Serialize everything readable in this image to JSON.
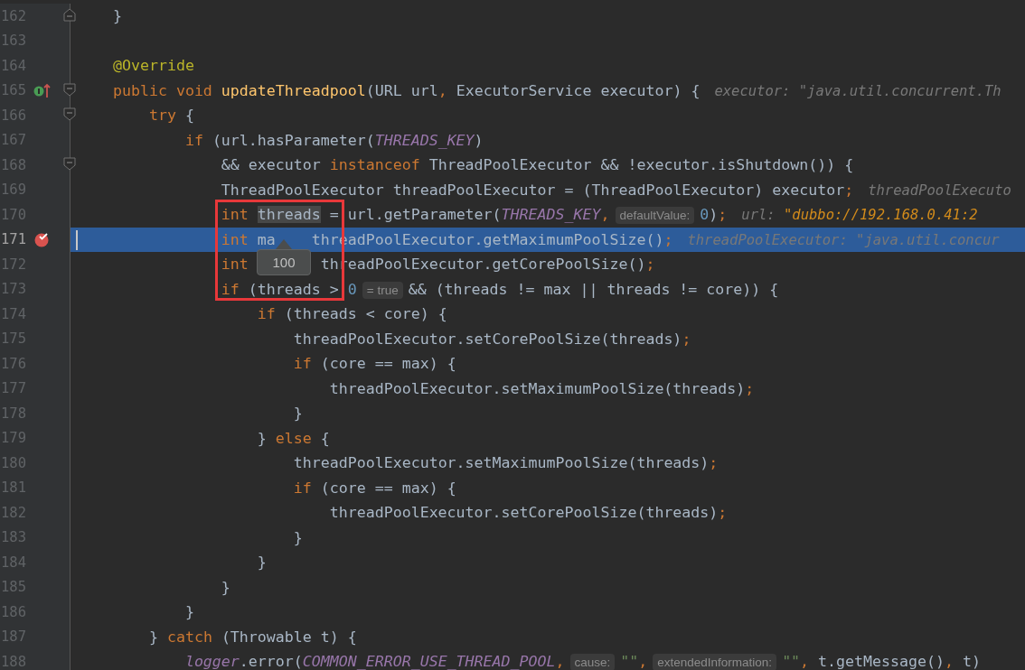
{
  "editor": {
    "lines": [
      {
        "number": "162",
        "current": false,
        "fold_end": true,
        "tokens": [
          {
            "text": "    }",
            "kind": "p"
          }
        ]
      },
      {
        "number": "163",
        "current": false
      },
      {
        "number": "164",
        "current": false,
        "tokens": [
          {
            "text": "    @Override",
            "kind": "a"
          }
        ]
      },
      {
        "number": "165",
        "current": false,
        "implements_marker": true,
        "fold_start": true,
        "tokens": [
          {
            "text": "    public void ",
            "kind": "k"
          },
          {
            "text": "updateThreadpool",
            "kind": "m"
          },
          {
            "text": "(URL url",
            "kind": "p"
          },
          {
            "text": ",",
            "kind": "o"
          },
          {
            "text": " ExecutorService executor) {",
            "kind": "p"
          },
          {
            "text": "executor: \"java.util.concurrent.Th",
            "kind": "d"
          }
        ]
      },
      {
        "number": "166",
        "current": false,
        "fold_start": true,
        "tokens": [
          {
            "text": "        try",
            "kind": "k"
          },
          {
            "text": " {",
            "kind": "p"
          }
        ]
      },
      {
        "number": "167",
        "current": false,
        "tokens": [
          {
            "text": "            if",
            "kind": "k"
          },
          {
            "text": " (url.hasParameter(",
            "kind": "p"
          },
          {
            "text": "THREADS_KEY",
            "kind": "c"
          },
          {
            "text": ")",
            "kind": "p"
          }
        ]
      },
      {
        "number": "168",
        "current": false,
        "fold_start": true,
        "tokens": [
          {
            "text": "                && executor ",
            "kind": "p"
          },
          {
            "text": "instanceof",
            "kind": "k"
          },
          {
            "text": " ThreadPoolExecutor && !executor.isShutdown()) {",
            "kind": "p"
          }
        ]
      },
      {
        "number": "169",
        "current": false,
        "tokens": [
          {
            "text": "                ThreadPoolExecutor threadPoolExecutor = (ThreadPoolExecutor) executor",
            "kind": "p"
          },
          {
            "text": ";",
            "kind": "o"
          },
          {
            "text": "threadPoolExecuto",
            "kind": "d"
          }
        ]
      },
      {
        "number": "170",
        "current": false,
        "tokens": [
          {
            "text": "                int ",
            "kind": "k"
          },
          {
            "text": "threads",
            "kind": "sel"
          },
          {
            "text": " = url.getParameter(",
            "kind": "p"
          },
          {
            "text": "THREADS_KEY",
            "kind": "c"
          },
          {
            "text": ",",
            "kind": "o"
          },
          {
            "text": "defaultValue:",
            "kind": "h"
          },
          {
            "text": "0",
            "kind": "n"
          },
          {
            "text": ")",
            "kind": "p"
          },
          {
            "text": ";",
            "kind": "o"
          },
          {
            "text": "url: ",
            "kind": "d"
          },
          {
            "text": "\"dubbo://192.168.0.41:2",
            "kind": "ds"
          }
        ]
      },
      {
        "number": "171",
        "current": true,
        "breakpoint": true,
        "tokens": [
          {
            "text": "                int",
            "kind": "k"
          },
          {
            "text": " ma",
            "kind": "p"
          },
          {
            "text": "    threadPoolExecutor.getMaximumPoolSize()",
            "kind": "p"
          },
          {
            "text": ";",
            "kind": "o"
          },
          {
            "text": "threadPoolExecutor: \"java.util.concur",
            "kind": "d"
          }
        ]
      },
      {
        "number": "172",
        "current": false,
        "tokens": [
          {
            "text": "                int",
            "kind": "k"
          },
          {
            "text": "        threadPoolExecutor.getCorePoolSize()",
            "kind": "p"
          },
          {
            "text": ";",
            "kind": "o"
          }
        ]
      },
      {
        "number": "173",
        "current": false,
        "tokens": [
          {
            "text": "                if",
            "kind": "k"
          },
          {
            "text": " (threads > ",
            "kind": "p"
          },
          {
            "text": "0",
            "kind": "n"
          },
          {
            "text": "= true",
            "kind": "h"
          },
          {
            "text": "&& (threads != max || threads != core)) {",
            "kind": "p"
          }
        ]
      },
      {
        "number": "174",
        "current": false,
        "tokens": [
          {
            "text": "                    if",
            "kind": "k"
          },
          {
            "text": " (threads < core) {",
            "kind": "p"
          }
        ]
      },
      {
        "number": "175",
        "current": false,
        "tokens": [
          {
            "text": "                        threadPoolExecutor.setCorePoolSize(threads)",
            "kind": "p"
          },
          {
            "text": ";",
            "kind": "o"
          }
        ]
      },
      {
        "number": "176",
        "current": false,
        "tokens": [
          {
            "text": "                        if",
            "kind": "k"
          },
          {
            "text": " (core == max) {",
            "kind": "p"
          }
        ]
      },
      {
        "number": "177",
        "current": false,
        "tokens": [
          {
            "text": "                            threadPoolExecutor.setMaximumPoolSize(threads)",
            "kind": "p"
          },
          {
            "text": ";",
            "kind": "o"
          }
        ]
      },
      {
        "number": "178",
        "current": false,
        "tokens": [
          {
            "text": "                        }",
            "kind": "p"
          }
        ]
      },
      {
        "number": "179",
        "current": false,
        "tokens": [
          {
            "text": "                    } ",
            "kind": "p"
          },
          {
            "text": "else",
            "kind": "k"
          },
          {
            "text": " {",
            "kind": "p"
          }
        ]
      },
      {
        "number": "180",
        "current": false,
        "tokens": [
          {
            "text": "                        threadPoolExecutor.setMaximumPoolSize(threads)",
            "kind": "p"
          },
          {
            "text": ";",
            "kind": "o"
          }
        ]
      },
      {
        "number": "181",
        "current": false,
        "tokens": [
          {
            "text": "                        if",
            "kind": "k"
          },
          {
            "text": " (core == max) {",
            "kind": "p"
          }
        ]
      },
      {
        "number": "182",
        "current": false,
        "tokens": [
          {
            "text": "                            threadPoolExecutor.setCorePoolSize(threads)",
            "kind": "p"
          },
          {
            "text": ";",
            "kind": "o"
          }
        ]
      },
      {
        "number": "183",
        "current": false,
        "tokens": [
          {
            "text": "                        }",
            "kind": "p"
          }
        ]
      },
      {
        "number": "184",
        "current": false,
        "tokens": [
          {
            "text": "                    }",
            "kind": "p"
          }
        ]
      },
      {
        "number": "185",
        "current": false,
        "tokens": [
          {
            "text": "                }",
            "kind": "p"
          }
        ]
      },
      {
        "number": "186",
        "current": false,
        "tokens": [
          {
            "text": "            }",
            "kind": "p"
          }
        ]
      },
      {
        "number": "187",
        "current": false,
        "tokens": [
          {
            "text": "        } ",
            "kind": "p"
          },
          {
            "text": "catch",
            "kind": "k"
          },
          {
            "text": " (Throwable t) {",
            "kind": "p"
          }
        ]
      },
      {
        "number": "188",
        "current": false,
        "tokens": [
          {
            "text": "            logger",
            "kind": "f"
          },
          {
            "text": ".error(",
            "kind": "p"
          },
          {
            "text": "COMMON_ERROR_USE_THREAD_POOL",
            "kind": "c"
          },
          {
            "text": ",",
            "kind": "o"
          },
          {
            "text": "cause:",
            "kind": "h"
          },
          {
            "text": "\"\"",
            "kind": "s"
          },
          {
            "text": ",",
            "kind": "o"
          },
          {
            "text": "extendedInformation:",
            "kind": "h"
          },
          {
            "text": "\"\"",
            "kind": "s"
          },
          {
            "text": ",",
            "kind": "o"
          },
          {
            "text": " t.getMessage()",
            "kind": "p"
          },
          {
            "text": ",",
            "kind": "o"
          },
          {
            "text": " t)",
            "kind": "p"
          }
        ]
      }
    ]
  },
  "tooltip": {
    "text": "100"
  }
}
